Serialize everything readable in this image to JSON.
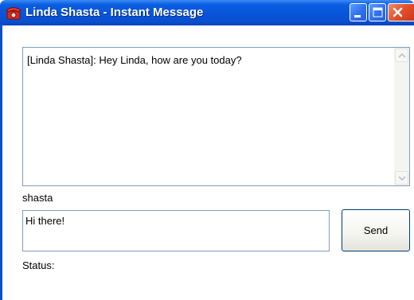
{
  "window": {
    "title": "Linda Shasta - Instant Message"
  },
  "icons": {
    "app": "telephone-icon",
    "minimize": "minimize-icon",
    "maximize": "maximize-icon",
    "close": "close-icon",
    "scroll_up": "scroll-up-arrow-icon",
    "scroll_down": "scroll-down-arrow-icon"
  },
  "chat": {
    "transcript": "[Linda Shasta]:  Hey Linda, how are you today?",
    "username": "shasta",
    "message_value": "Hi there!",
    "send_label": "Send",
    "status_label": "Status:"
  },
  "colors": {
    "titlebar": "#0854d8",
    "close_button": "#e2502a",
    "input_border": "#7f9db9"
  }
}
